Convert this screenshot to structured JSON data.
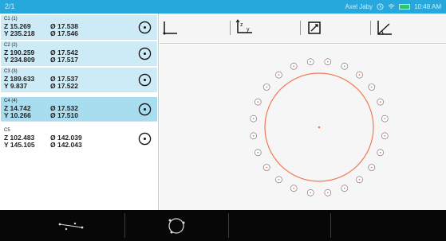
{
  "status_bar": {
    "title": "2/1",
    "user_label": "Axel Jaby",
    "time": "10:48 AM",
    "icons": [
      "clock-icon",
      "wifi-icon",
      "battery-icon"
    ],
    "accent": "#27a8dd"
  },
  "features": [
    {
      "name": "C1 (1)",
      "z": "Z 15.269",
      "y": "Y 235.218",
      "d1": "Ø 17.538",
      "d2": "Ø 17.546",
      "state": "light"
    },
    {
      "name": "C2 (2)",
      "z": "Z 190.259",
      "y": "Y 234.809",
      "d1": "Ø 17.542",
      "d2": "Ø 17.517",
      "state": "light"
    },
    {
      "name": "C3 (3)",
      "z": "Z 189.633",
      "y": "Y 9.837",
      "d1": "Ø 17.537",
      "d2": "Ø 17.522",
      "state": "light"
    },
    {
      "name": "C4 (4)",
      "z": "Z 14.742",
      "y": "Y 10.266",
      "d1": "Ø 17.532",
      "d2": "Ø 17.510",
      "state": "selected"
    },
    {
      "name": "C5",
      "z": "Z 102.483",
      "y": "Y 145.105",
      "d1": "Ø 142.039",
      "d2": "Ø 142.043",
      "state": "normal"
    }
  ],
  "toolbar": {
    "tools": [
      "axis-origin-icon",
      "axis-zy-icon",
      "rotate-frame-icon",
      "measure-angle-icon"
    ],
    "axis_labels": {
      "z": "z",
      "y": "y"
    }
  },
  "viewer": {
    "circle_color": "#f07a55",
    "hole_color": "#f07a55",
    "hole_count": 24
  },
  "bottom_bar": {
    "buttons": [
      "distance-points-icon",
      "circle-points-icon",
      "blank-button-3",
      "blank-button-4",
      "blank-button-5"
    ]
  }
}
